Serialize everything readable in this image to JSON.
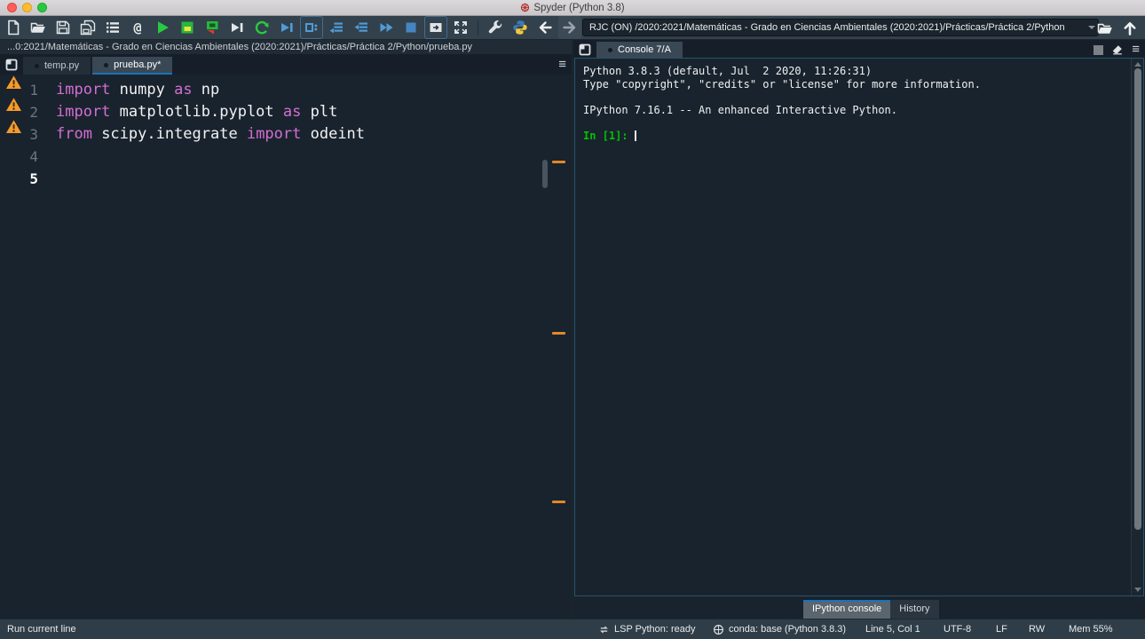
{
  "window": {
    "title": "Spyder (Python 3.8)"
  },
  "toolbar": {
    "path_value": "RJC (ON) /2020:2021/Matemáticas - Grado en Ciencias Ambientales (2020:2021)/Prácticas/Práctica 2/Python",
    "buttons": [
      "new-file",
      "open-file",
      "save",
      "save-all",
      "file-switcher",
      "symbol-finder",
      "run-file",
      "run-cell",
      "run-cell-advance",
      "run-selection",
      "rerun-cell",
      "debug-file",
      "debug-cell",
      "step-over",
      "step-into",
      "continue-execution",
      "stop-debug",
      "fullscreen",
      "maximize-pane",
      "preferences",
      "python-path-manager",
      "back",
      "forward",
      "browse-working-directory",
      "go-up"
    ]
  },
  "icons": {
    "symbol_finder": "@",
    "pane_menu": "≡"
  },
  "editor": {
    "breadcrumb": "...0:2021/Matemáticas - Grado en Ciencias Ambientales (2020:2021)/Prácticas/Práctica 2/Python/prueba.py",
    "tabs": [
      {
        "label": "temp.py",
        "active": false
      },
      {
        "label": "prueba.py*",
        "active": true
      }
    ],
    "lines": [
      {
        "number": "1",
        "warning": true,
        "current": false,
        "segments": [
          {
            "type": "keyword",
            "text": "import"
          },
          {
            "type": "plain",
            "text": " numpy "
          },
          {
            "type": "keyword",
            "text": "as"
          },
          {
            "type": "plain",
            "text": " np"
          }
        ]
      },
      {
        "number": "2",
        "warning": true,
        "current": false,
        "segments": [
          {
            "type": "keyword",
            "text": "import"
          },
          {
            "type": "plain",
            "text": " matplotlib.pyplot "
          },
          {
            "type": "keyword",
            "text": "as"
          },
          {
            "type": "plain",
            "text": " plt"
          }
        ]
      },
      {
        "number": "3",
        "warning": true,
        "current": false,
        "segments": [
          {
            "type": "keyword",
            "text": "from"
          },
          {
            "type": "plain",
            "text": " scipy.integrate "
          },
          {
            "type": "keyword",
            "text": "import"
          },
          {
            "type": "plain",
            "text": " odeint"
          }
        ]
      },
      {
        "number": "4",
        "warning": false,
        "current": false,
        "segments": []
      },
      {
        "number": "5",
        "warning": false,
        "current": true,
        "segments": []
      }
    ]
  },
  "console": {
    "tab": "Console 7/A",
    "banner_lines": [
      "Python 3.8.3 (default, Jul  2 2020, 11:26:31)",
      "Type \"copyright\", \"credits\" or \"license\" for more information.",
      "",
      "IPython 7.16.1 -- An enhanced Interactive Python.",
      ""
    ],
    "prompt": "In [1]:",
    "bottom_tabs": [
      {
        "label": "IPython console",
        "active": true
      },
      {
        "label": "History",
        "active": false
      }
    ]
  },
  "statusbar": {
    "message": "Run current line",
    "lsp": "LSP Python: ready",
    "conda": "conda: base (Python 3.8.3)",
    "cursor": "Line 5, Col 1",
    "encoding": "UTF-8",
    "eol": "LF",
    "permissions": "RW",
    "memory": "Mem 55%"
  },
  "colors": {
    "accent_blue": "#1A72BB",
    "debug_blue": "#4f9bd8",
    "run_green": "#29c940",
    "warning_orange": "#F79A2D",
    "keyword_magenta": "#d36ed4",
    "prompt_green": "#00c300",
    "editor_bg": "#19232D",
    "chrome_bg": "#32414B"
  }
}
